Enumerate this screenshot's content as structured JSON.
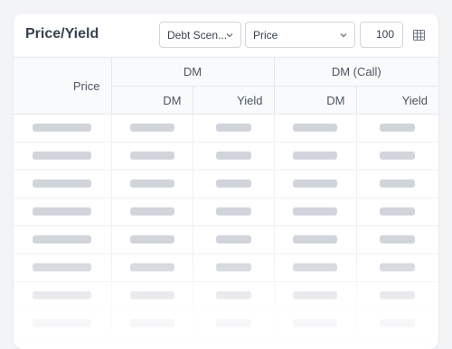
{
  "card": {
    "title": "Price/Yield"
  },
  "controls": {
    "scenario_select": {
      "value": "Debt Scen..."
    },
    "metric_select": {
      "value": "Price"
    },
    "amount_input": {
      "value": "100"
    },
    "grid_toggle_icon": "table-grid-icon"
  },
  "table": {
    "price_header": "Price",
    "groups": [
      {
        "label": "DM",
        "columns": [
          "DM",
          "Yield"
        ]
      },
      {
        "label": "DM (Call)",
        "columns": [
          "DM",
          "Yield"
        ]
      }
    ],
    "loading_rows": 8
  },
  "colors": {
    "title": "#374151",
    "header_bg": "#f9fafb",
    "border": "#e5e7eb",
    "skeleton": "#d1d5db"
  }
}
